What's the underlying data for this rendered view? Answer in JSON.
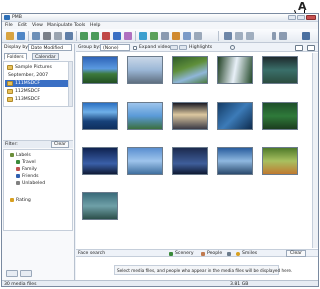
{
  "callout": {
    "label": "A"
  },
  "window": {
    "title": "PMB"
  },
  "menu": [
    "File",
    "Edit",
    "View",
    "Manipulate",
    "Tools",
    "Help"
  ],
  "left": {
    "display_by_label": "Display by:",
    "display_by_value": "Date Modified",
    "tabs": [
      "Folders",
      "Calendar"
    ],
    "folders": [
      {
        "label": "Sample Pictures",
        "selected": false
      },
      {
        "label": "September, 2007",
        "selected": false
      },
      {
        "label": "111MSDCF",
        "selected": true
      },
      {
        "label": "112MSDCF",
        "selected": false
      },
      {
        "label": "113MSDCF",
        "selected": false
      }
    ],
    "filter_label": "Filter:",
    "filter_button": "Clear",
    "filter_items": [
      {
        "label": "Labels",
        "indent": 0,
        "color": "#6b8e3a"
      },
      {
        "label": "Travel",
        "indent": 1,
        "color": "#3a8a3a"
      },
      {
        "label": "Family",
        "indent": 1,
        "color": "#c05050"
      },
      {
        "label": "Friends",
        "indent": 1,
        "color": "#3060b0"
      },
      {
        "label": "Unlabeled",
        "indent": 1,
        "color": "#808080"
      },
      {
        "label": "Rating",
        "indent": 0,
        "color": "#d8a020"
      }
    ]
  },
  "main": {
    "group_label": "Group by:",
    "group_value": "(None)",
    "expand_label": "Expand videos",
    "highlights_label": "Highlights",
    "face_search_label": "Face search",
    "face_buttons": [
      "Scenery",
      "People",
      "Smiles"
    ],
    "face_message": "Select media files, and people who appear in the media files will be displayed here.",
    "face_clear": "Clear"
  },
  "status": {
    "left": "30 media files",
    "right": "3.81 GB"
  },
  "colors": {
    "accent": "#3a6fc4",
    "frame": "#7a8aa0"
  }
}
